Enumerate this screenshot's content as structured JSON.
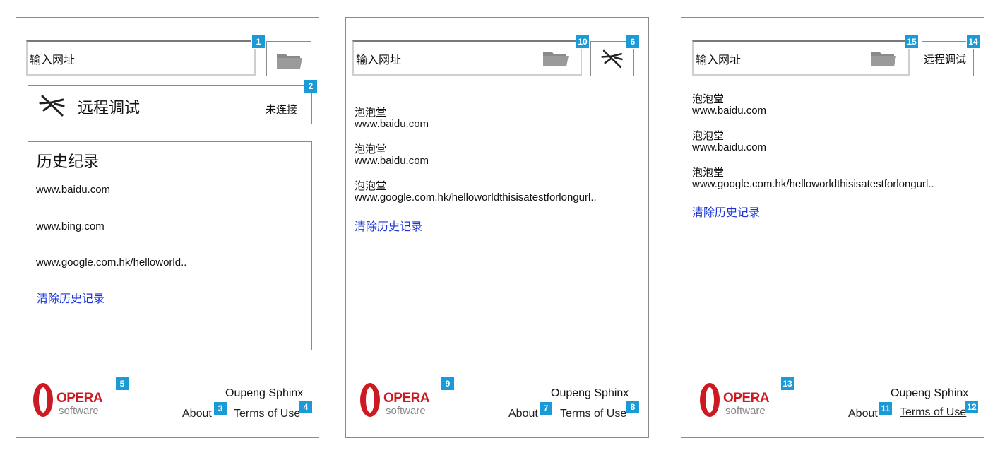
{
  "common": {
    "url_placeholder": "输入网址",
    "brand": "Oupeng Sphinx",
    "about": "About",
    "terms": "Terms of Use",
    "clear_history": "清除历史记录",
    "opera_word": "OPERA",
    "opera_sub": "software",
    "colors": {
      "badge": "#1a9ad6",
      "link": "#1a33d8",
      "opera_red": "#cc1a23"
    }
  },
  "panel1": {
    "remote_label": "远程调试",
    "remote_status": "未连接",
    "history_title": "历史纪录",
    "history_items": [
      "www.baidu.com",
      "www.bing.com",
      "www.google.com.hk/helloworld.."
    ],
    "badges": [
      "1",
      "2",
      "3",
      "4",
      "5"
    ]
  },
  "panel2": {
    "entries": [
      {
        "title": "泡泡堂",
        "url": "www.baidu.com"
      },
      {
        "title": "泡泡堂",
        "url": "www.baidu.com"
      },
      {
        "title": "泡泡堂",
        "url": "www.google.com.hk/helloworldthisisatestforlongurl.."
      }
    ],
    "badges": [
      "10",
      "6",
      "9",
      "7",
      "8"
    ]
  },
  "panel3": {
    "remote_button": "远程调试",
    "entries": [
      {
        "title": "泡泡堂",
        "url": "www.baidu.com"
      },
      {
        "title": "泡泡堂",
        "url": "www.baidu.com"
      },
      {
        "title": "泡泡堂",
        "url": "www.google.com.hk/helloworldthisisatestforlongurl.."
      }
    ],
    "badges": [
      "15",
      "14",
      "13",
      "11",
      "12"
    ]
  }
}
